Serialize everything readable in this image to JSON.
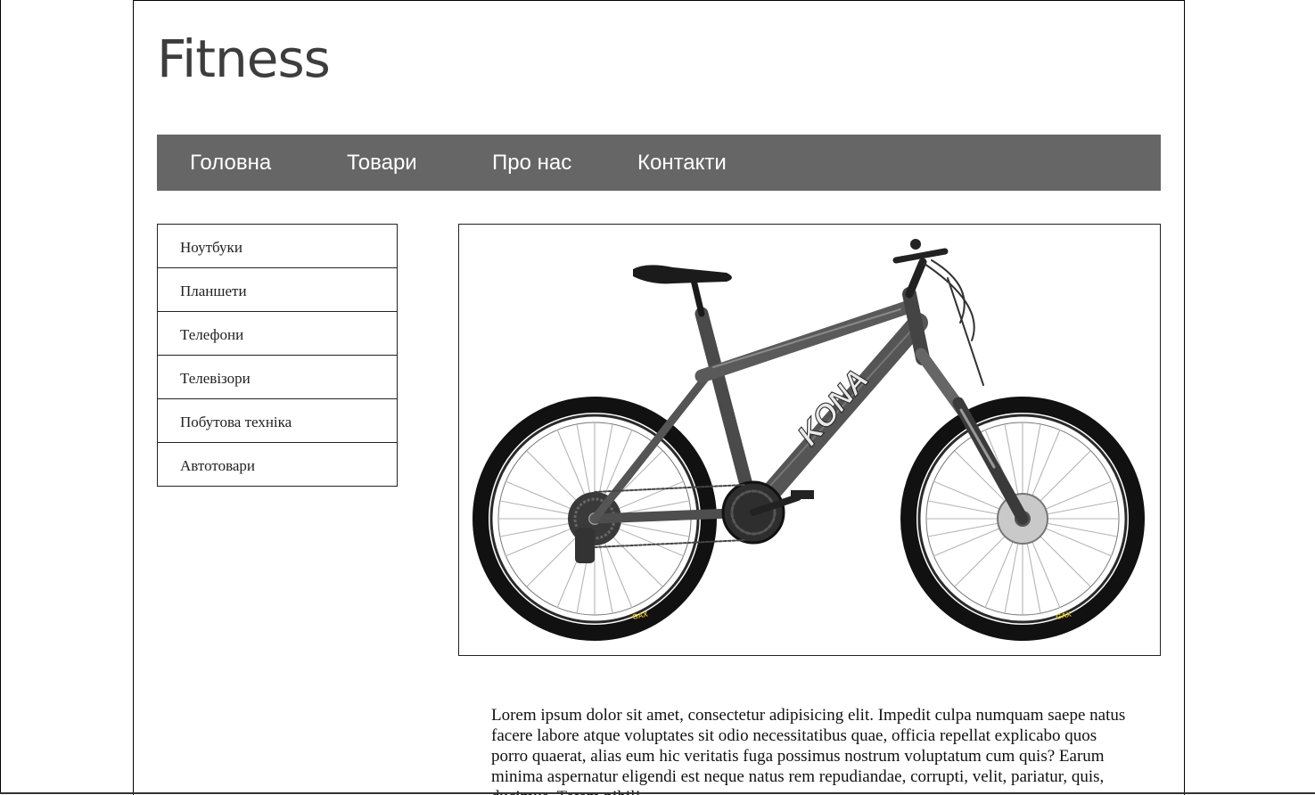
{
  "site": {
    "logo": "Fitness"
  },
  "nav": {
    "items": [
      {
        "label": "Головна"
      },
      {
        "label": "Товари"
      },
      {
        "label": "Про нас"
      },
      {
        "label": "Контакти"
      }
    ]
  },
  "sidebar": {
    "items": [
      {
        "label": "Ноутбуки"
      },
      {
        "label": "Планшети"
      },
      {
        "label": "Телефони"
      },
      {
        "label": "Телевізори"
      },
      {
        "label": "Побутова техніка"
      },
      {
        "label": "Автотовари"
      }
    ]
  },
  "product": {
    "image": {
      "icon": "mountain-bike-image",
      "brand_text": "KONA",
      "tire_text": "GAX SAGUARO"
    },
    "description": "Lorem ipsum dolor sit amet, consectetur adipisicing elit. Impedit culpa numquam saepe natus facere labore atque voluptates sit odio necessitatibus quae, officia repellat explicabo quos porro quaerat, alias eum hic veritatis fuga possimus nostrum voluptatum cum quis? Earum minima aspernatur eligendi est neque natus rem repudiandae, corrupti, velit, pariatur, quis, ducimus. Totam nihil!"
  },
  "colors": {
    "nav_bg": "#666666",
    "nav_text": "#ffffff",
    "logo": "#3d3d3d",
    "border": "#222222"
  }
}
